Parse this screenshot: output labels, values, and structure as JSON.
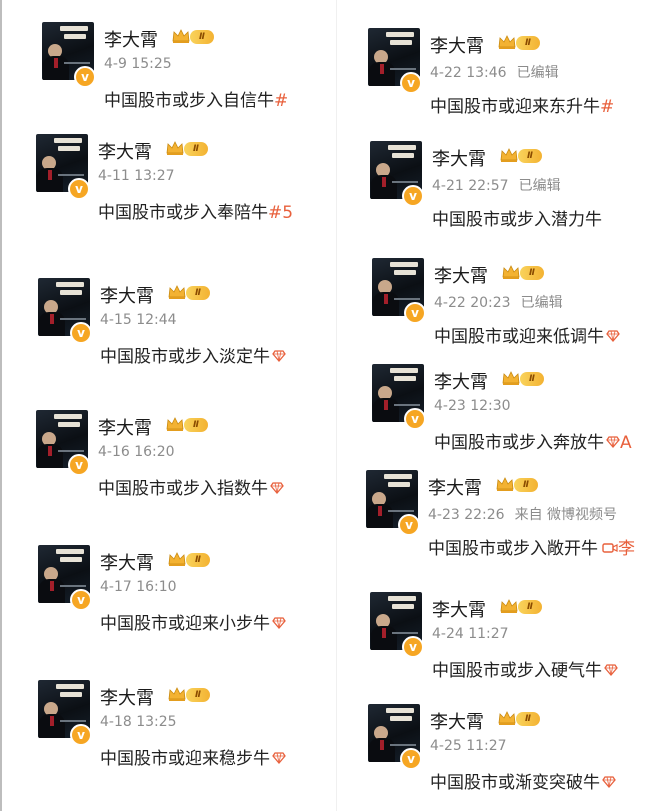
{
  "author": {
    "name": "李大霄",
    "level_badge": "Ⅱ",
    "verified_icon": "v-verified-icon",
    "crown_icon": "crown-icon"
  },
  "colors": {
    "accent": "#e8603c",
    "badge_gold": "#f6a623",
    "meta_gray": "#8c8c8c"
  },
  "left_posts": [
    {
      "time": "4-9 15:25",
      "extra": "",
      "text": "中国股市或步入自信牛",
      "tail": "#",
      "tail_icon": ""
    },
    {
      "time": "4-11 13:27",
      "extra": "",
      "text": "中国股市或步入奉陪牛",
      "tail": "#5",
      "tail_icon": ""
    },
    {
      "time": "4-15 12:44",
      "extra": "",
      "text": "中国股市或步入淡定牛",
      "tail": "",
      "tail_icon": "diamond-icon"
    },
    {
      "time": "4-16 16:20",
      "extra": "",
      "text": "中国股市或步入指数牛",
      "tail": "",
      "tail_icon": "diamond-icon"
    },
    {
      "time": "4-17 16:10",
      "extra": "",
      "text": "中国股市或迎来小步牛",
      "tail": "",
      "tail_icon": "diamond-icon"
    },
    {
      "time": "4-18 13:25",
      "extra": "",
      "text": "中国股市或迎来稳步牛",
      "tail": "",
      "tail_icon": "diamond-icon"
    }
  ],
  "right_posts": [
    {
      "time": "4-22 13:46",
      "extra": "已编辑",
      "text": "中国股市或迎来东升牛",
      "tail": "#",
      "tail_icon": ""
    },
    {
      "time": "4-21 22:57",
      "extra": "已编辑",
      "text": "中国股市或步入潜力牛",
      "tail": "",
      "tail_icon": ""
    },
    {
      "time": "4-22 20:23",
      "extra": "已编辑",
      "text": "中国股市或迎来低调牛",
      "tail": "",
      "tail_icon": "diamond-icon"
    },
    {
      "time": "4-23 12:30",
      "extra": "",
      "text": "中国股市或步入奔放牛",
      "tail": "A",
      "tail_icon": "diamond-icon"
    },
    {
      "time": "4-23 22:26",
      "extra": "来自 微博视频号",
      "text": "中国股市或步入敞开牛",
      "tail": "李",
      "tail_icon": "video-icon"
    },
    {
      "time": "4-24 11:27",
      "extra": "",
      "text": "中国股市或步入硬气牛",
      "tail": "",
      "tail_icon": "diamond-icon"
    },
    {
      "time": "4-25 11:27",
      "extra": "",
      "text": "中国股市或渐变突破牛",
      "tail": "",
      "tail_icon": "diamond-icon"
    }
  ]
}
